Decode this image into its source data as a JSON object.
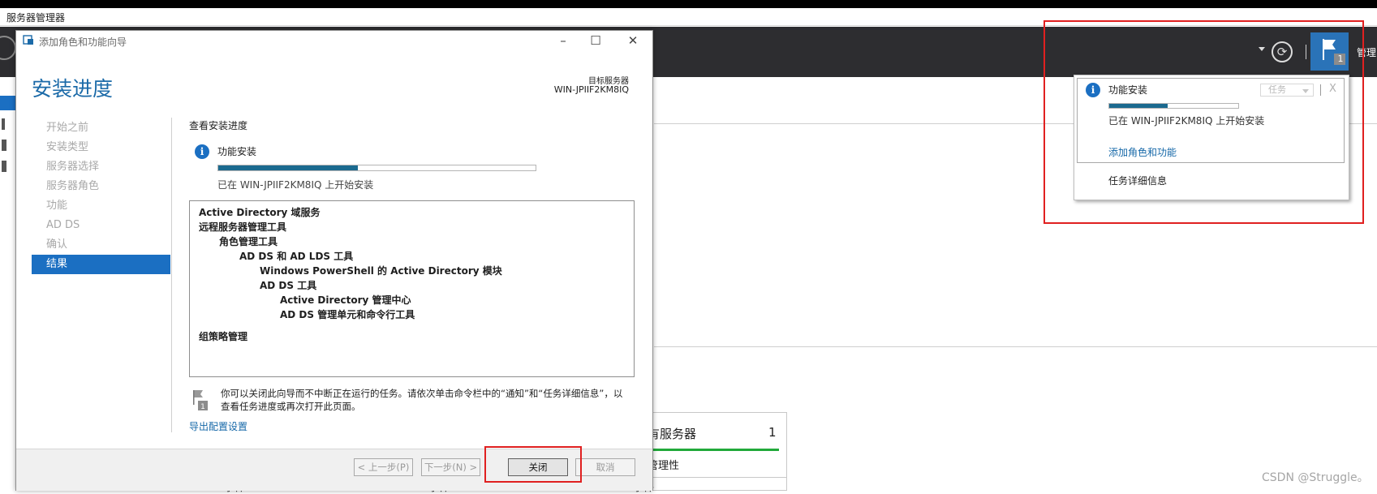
{
  "app": {
    "title": "服务器管理器",
    "manage_label": "管理(",
    "notification_count": "1"
  },
  "notification_popup": {
    "title": "功能安装",
    "task_dropdown": "任务",
    "close_label": "X",
    "progress_fraction": 0.45,
    "status_text": "已在 WIN-JPIIF2KM8IQ 上开始安装",
    "link_label": "添加角色和功能",
    "task_details_label": "任务详细信息"
  },
  "wizard": {
    "window_title": "添加角色和功能向导",
    "heading": "安装进度",
    "destination_label": "目标服务器",
    "destination_value": "WIN-JPIIF2KM8IQ",
    "nav": [
      {
        "label": "开始之前",
        "active": false
      },
      {
        "label": "安装类型",
        "active": false
      },
      {
        "label": "服务器选择",
        "active": false
      },
      {
        "label": "服务器角色",
        "active": false
      },
      {
        "label": "功能",
        "active": false
      },
      {
        "label": "AD DS",
        "active": false
      },
      {
        "label": "确认",
        "active": false
      },
      {
        "label": "结果",
        "active": true
      }
    ],
    "section_title": "查看安装进度",
    "install_title": "功能安装",
    "progress_fraction": 0.44,
    "install_status": "已在 WIN-JPIIF2KM8IQ 上开始安装",
    "features": [
      {
        "text": "Active Directory 域服务",
        "level": 0
      },
      {
        "text": "远程服务器管理工具",
        "level": 0
      },
      {
        "text": "角色管理工具",
        "level": 1
      },
      {
        "text": "AD DS 和 AD LDS 工具",
        "level": 2
      },
      {
        "text": "Windows PowerShell 的 Active Directory 模块",
        "level": 3
      },
      {
        "text": "AD DS 工具",
        "level": 3
      },
      {
        "text": "Active Directory 管理中心",
        "level": 4
      },
      {
        "text": "AD DS 管理单元和命令行工具",
        "level": 4
      },
      {
        "text": "组策略管理",
        "level": 0
      }
    ],
    "note_line1": "你可以关闭此向导而不中断正在运行的任务。请依次单击命令栏中的“通知”和“任务详细信息”，以",
    "note_line2": "查看任务进度或再次打开此页面。",
    "export_link": "导出配置设置",
    "buttons": {
      "prev": "< 上一步(P)",
      "next": "下一步(N) >",
      "close": "关闭",
      "cancel": "取消"
    }
  },
  "background": {
    "card_title": "有服务器",
    "card_count": "1",
    "card_subtitle": "管理性",
    "event_labels": [
      "事件",
      "事件",
      "事件"
    ]
  },
  "watermark": "CSDN @Struggle。"
}
